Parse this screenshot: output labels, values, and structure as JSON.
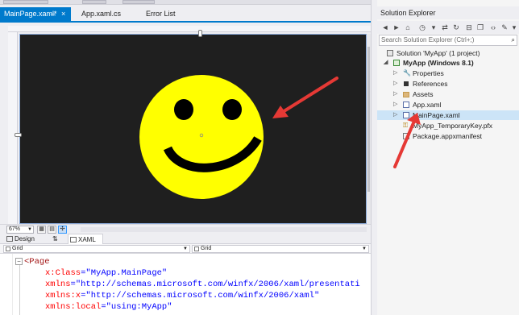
{
  "document_tabs": [
    {
      "label": "MainPage.xaml*",
      "active": true
    },
    {
      "label": "App.xaml.cs",
      "active": false
    },
    {
      "label": "Error List",
      "active": false
    }
  ],
  "designer": {
    "zoom": "67%",
    "artboard_color": "#1f1f1f",
    "smiley": {
      "face_color": "#ffff00",
      "feature_color": "#000000"
    }
  },
  "pane_tabs": {
    "design": "Design",
    "xaml": "XAML"
  },
  "element_selectors": {
    "left": "Grid",
    "right": "Grid"
  },
  "xaml_code": [
    {
      "tag": "<Page"
    },
    {
      "attr": "x:Class",
      "value": "\"MyApp.MainPage\""
    },
    {
      "attr": "xmlns",
      "value": "\"http://schemas.microsoft.com/winfx/2006/xaml/presentati"
    },
    {
      "attr": "xmlns:x",
      "value": "\"http://schemas.microsoft.com/winfx/2006/xaml\""
    },
    {
      "attr": "xmlns:local",
      "value": "\"using:MyApp\""
    }
  ],
  "solution_explorer": {
    "title": "Solution Explorer",
    "search_placeholder": "Search Solution Explorer (Ctrl+;)",
    "tree": [
      {
        "label": "Solution 'MyApp' (1 project)",
        "bold": false,
        "selected": false
      },
      {
        "label": "MyApp (Windows 8.1)",
        "bold": true,
        "selected": false
      },
      {
        "label": "Properties",
        "bold": false,
        "selected": false
      },
      {
        "label": "References",
        "bold": false,
        "selected": false
      },
      {
        "label": "Assets",
        "bold": false,
        "selected": false
      },
      {
        "label": "App.xaml",
        "bold": false,
        "selected": false
      },
      {
        "label": "MainPage.xaml",
        "bold": false,
        "selected": true
      },
      {
        "label": "MyApp_TemporaryKey.pfx",
        "bold": false,
        "selected": false
      },
      {
        "label": "Package.appxmanifest",
        "bold": false,
        "selected": false
      }
    ]
  },
  "colors": {
    "accent": "#007acc",
    "annotation_arrow": "#e53935",
    "selection": "#cce4f7"
  }
}
